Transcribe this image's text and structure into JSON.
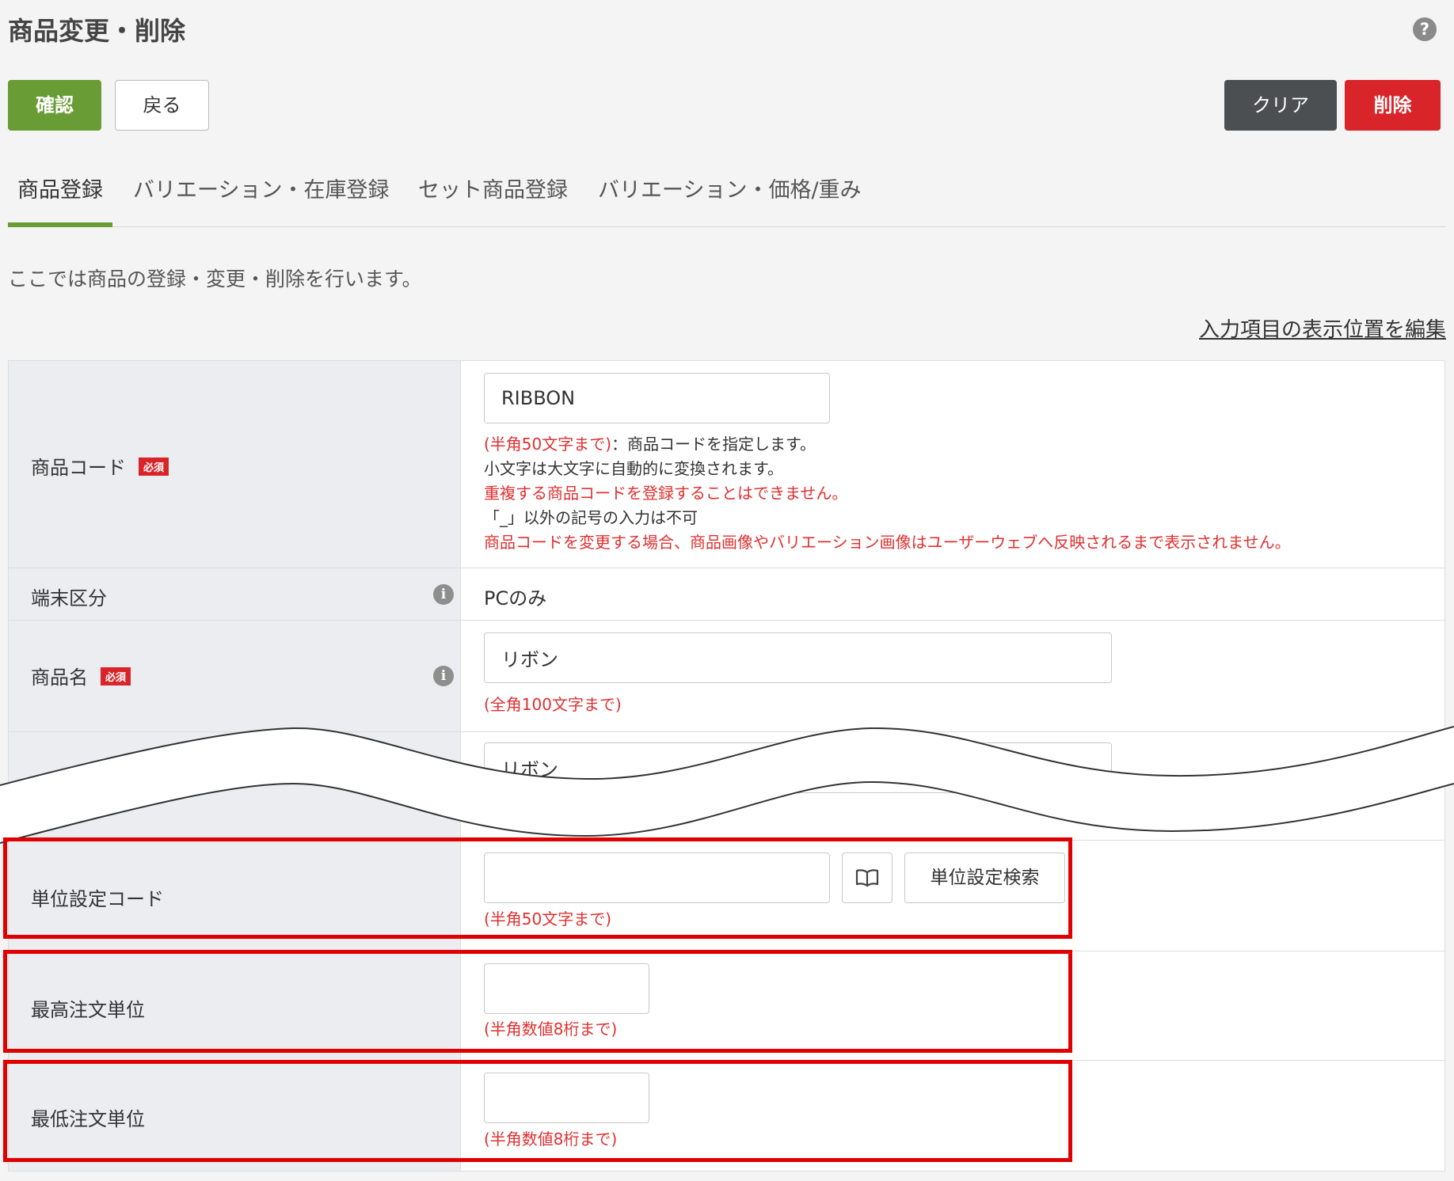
{
  "header": {
    "title": "商品変更・削除",
    "help_icon": "?"
  },
  "toolbar": {
    "confirm_label": "確認",
    "back_label": "戻る",
    "clear_label": "クリア",
    "delete_label": "削除"
  },
  "tabs": [
    {
      "label": "商品登録",
      "active": true
    },
    {
      "label": "バリエーション・在庫登録",
      "active": false
    },
    {
      "label": "セット商品登録",
      "active": false
    },
    {
      "label": "バリエーション・価格/重み",
      "active": false
    }
  ],
  "intro_text": "ここでは商品の登録・変更・削除を行います。",
  "edit_link": "入力項目の表示位置を編集",
  "required_badge": "必須",
  "info_icon": "i",
  "fields": {
    "product_code": {
      "label": "商品コード",
      "value": "RIBBON",
      "hint_limit": "(半角50文字まで)",
      "hint_desc": "：商品コードを指定します。",
      "hint_line2": "小文字は大文字に自動的に変換されます。",
      "hint_line3": "重複する商品コードを登録することはできません。",
      "hint_line4": "「_」以外の記号の入力は不可",
      "hint_line5": "商品コードを変更する場合、商品画像やバリエーション画像はユーザーウェブへ反映されるまで表示されません。"
    },
    "device_type": {
      "label": "端末区分",
      "value": "PCのみ"
    },
    "product_name": {
      "label": "商品名",
      "value": "リボン",
      "hint": "(全角100文字まで)"
    },
    "hidden_row": {
      "value": "リボン"
    },
    "unit_setting_code": {
      "label": "単位設定コード",
      "value": "",
      "hint": "(半角50文字まで)",
      "search_label": "単位設定検索",
      "book_icon": "book-icon"
    },
    "max_order_unit": {
      "label": "最高注文単位",
      "value": "",
      "hint": "(半角数値8桁まで)"
    },
    "min_order_unit": {
      "label": "最低注文単位",
      "value": "",
      "hint": "(半角数値8桁まで)"
    }
  },
  "colors": {
    "accent": "#6a9c35",
    "danger": "#d9252a",
    "dark_button": "#4b4f52",
    "highlight": "#e00000",
    "hint_red": "#e03030"
  }
}
